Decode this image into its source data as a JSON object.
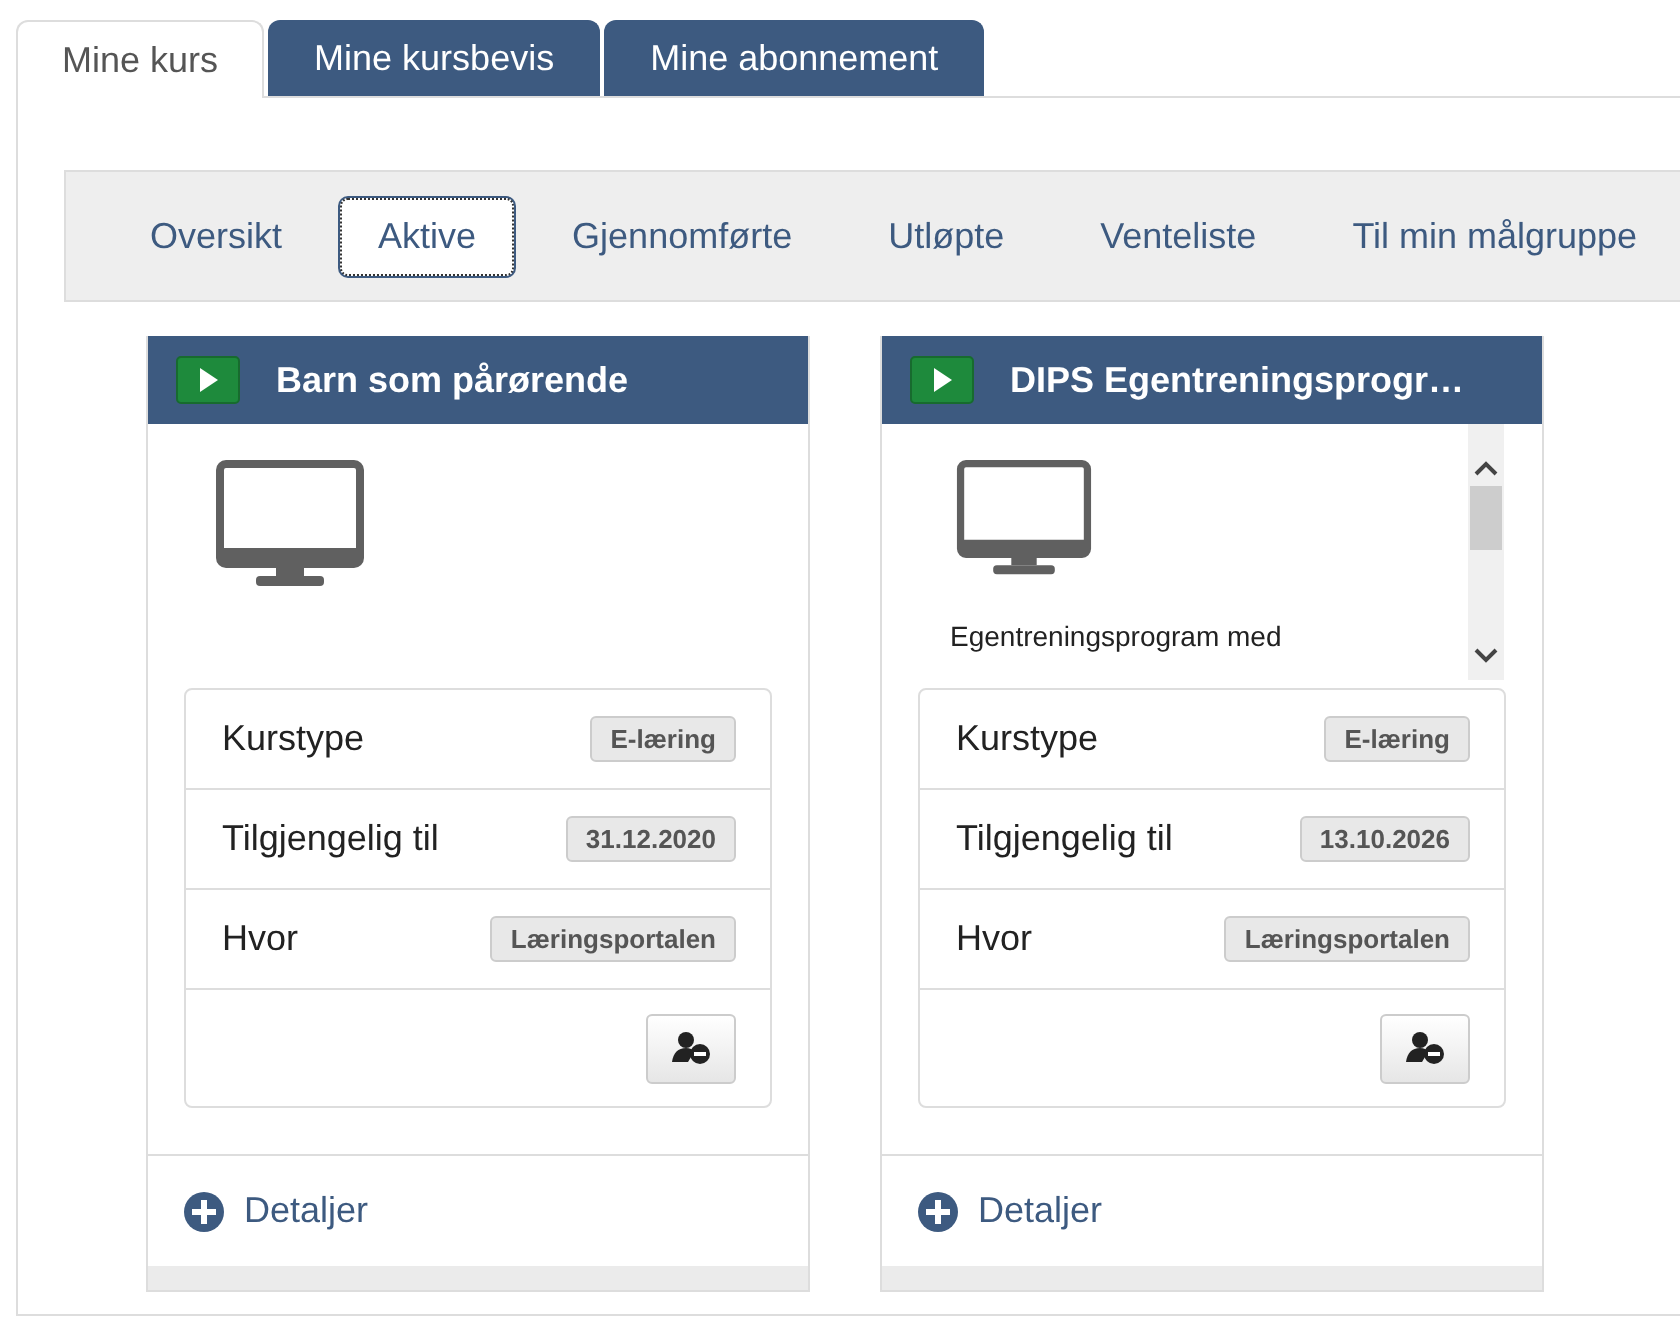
{
  "tabs": [
    {
      "label": "Mine kurs",
      "selected": true
    },
    {
      "label": "Mine kursbevis",
      "selected": false
    },
    {
      "label": "Mine abonnement",
      "selected": false
    }
  ],
  "subnav": [
    {
      "label": "Oversikt",
      "selected": false
    },
    {
      "label": "Aktive",
      "selected": true
    },
    {
      "label": "Gjennomførte",
      "selected": false
    },
    {
      "label": "Utløpte",
      "selected": false
    },
    {
      "label": "Venteliste",
      "selected": false
    },
    {
      "label": "Til min målgruppe",
      "selected": false
    }
  ],
  "courses": [
    {
      "title": "Barn som pårørende",
      "rows": [
        {
          "label": "Kurstype",
          "value": "E-læring"
        },
        {
          "label": "Tilgjengelig til",
          "value": "31.12.2020"
        },
        {
          "label": "Hvor",
          "value": "Læringsportalen"
        }
      ],
      "details": "Detaljer"
    },
    {
      "title": "DIPS Egentreningsprogr…",
      "description": "Egentreningsprogram med",
      "rows": [
        {
          "label": "Kurstype",
          "value": "E-læring"
        },
        {
          "label": "Tilgjengelig til",
          "value": "13.10.2026"
        },
        {
          "label": "Hvor",
          "value": "Læringsportalen"
        }
      ],
      "details": "Detaljer"
    }
  ]
}
